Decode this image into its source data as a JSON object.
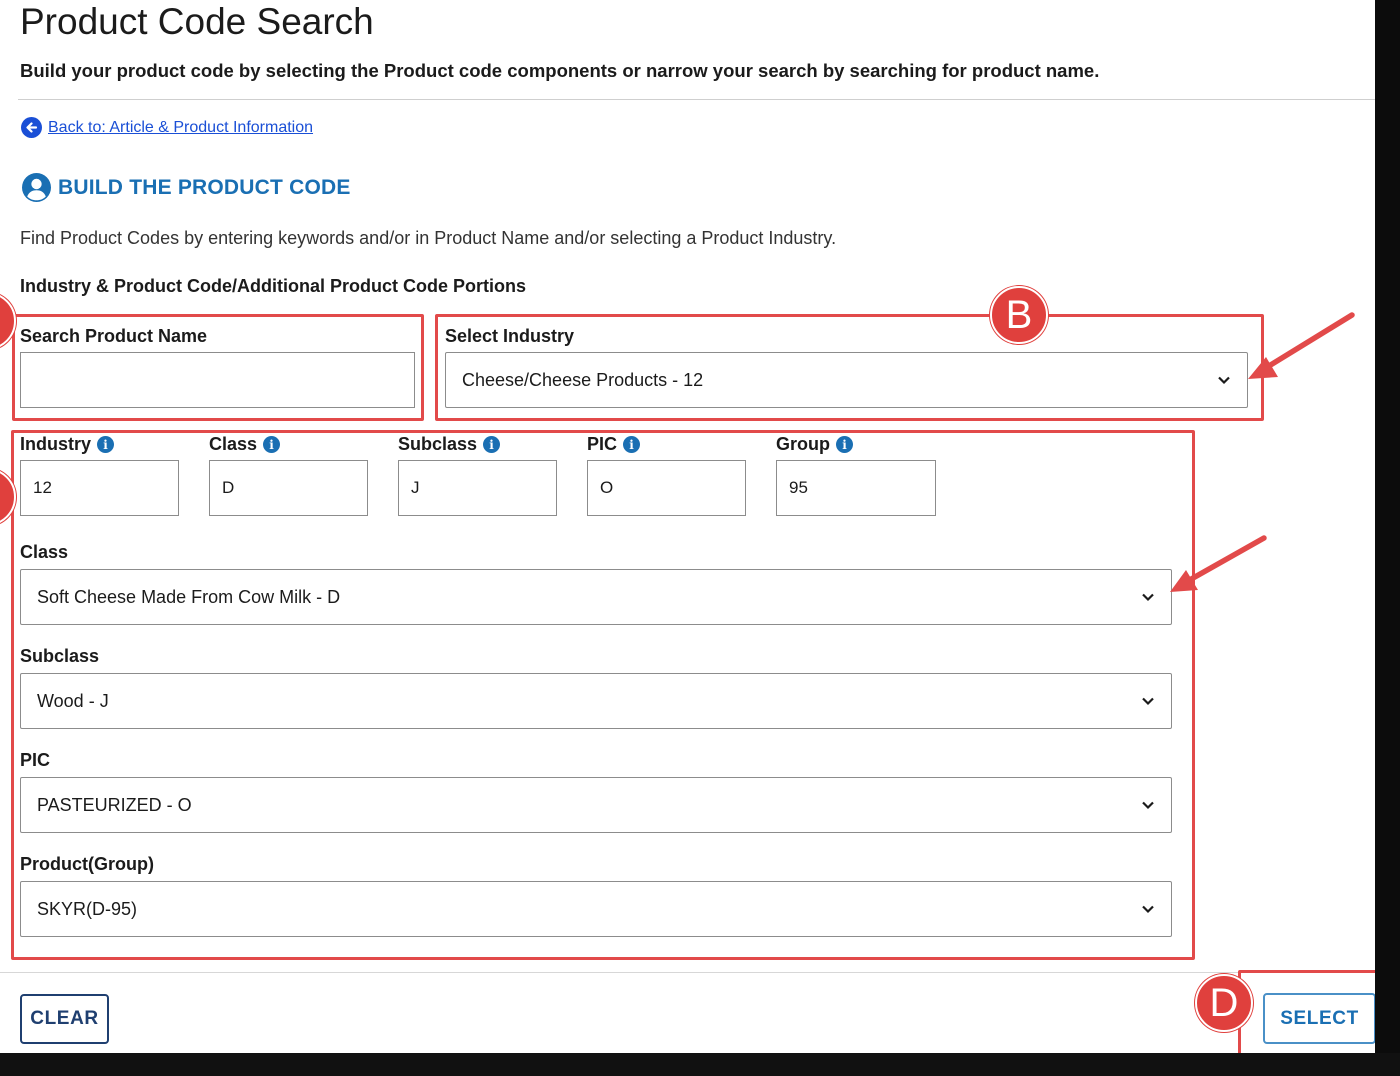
{
  "header": {
    "title": "Product Code Search",
    "subtitle": "Build your product code by selecting the Product code components or narrow your search by searching for product name."
  },
  "back_link": {
    "label": "Back to: Article & Product Information"
  },
  "section": {
    "title": "BUILD THE PRODUCT CODE",
    "intro": "Find Product Codes by entering keywords and/or in Product Name and/or selecting a Product Industry.",
    "group_label": "Industry & Product Code/Additional Product Code Portions"
  },
  "search_product_name": {
    "label": "Search Product Name",
    "value": ""
  },
  "select_industry": {
    "label": "Select Industry",
    "value": "Cheese/Cheese Products - 12"
  },
  "code_parts": [
    {
      "label": "Industry",
      "value": "12"
    },
    {
      "label": "Class",
      "value": "D"
    },
    {
      "label": "Subclass",
      "value": "J"
    },
    {
      "label": "PIC",
      "value": "O"
    },
    {
      "label": "Group",
      "value": "95"
    }
  ],
  "class_select": {
    "label": "Class",
    "value": "Soft Cheese Made From Cow Milk - D"
  },
  "subclass_select": {
    "label": "Subclass",
    "value": "Wood - J"
  },
  "pic_select": {
    "label": "PIC",
    "value": "PASTEURIZED - O"
  },
  "group_select": {
    "label": "Product(Group)",
    "value": "SKYR(D-95)"
  },
  "buttons": {
    "clear": "CLEAR",
    "select": "SELECT"
  },
  "annotations": {
    "b": "B",
    "d": "D"
  },
  "icons": {
    "back": "arrow-left-circle-icon",
    "section": "person-circle-icon",
    "info": "info-icon",
    "dropdown": "chevron-down-icon"
  },
  "colors": {
    "link_blue": "#1a4fd6",
    "section_blue": "#1a6fb3",
    "annotation_red": "#e24a4a",
    "clear_border": "#1f3f70",
    "select_border": "#4a90c7"
  }
}
